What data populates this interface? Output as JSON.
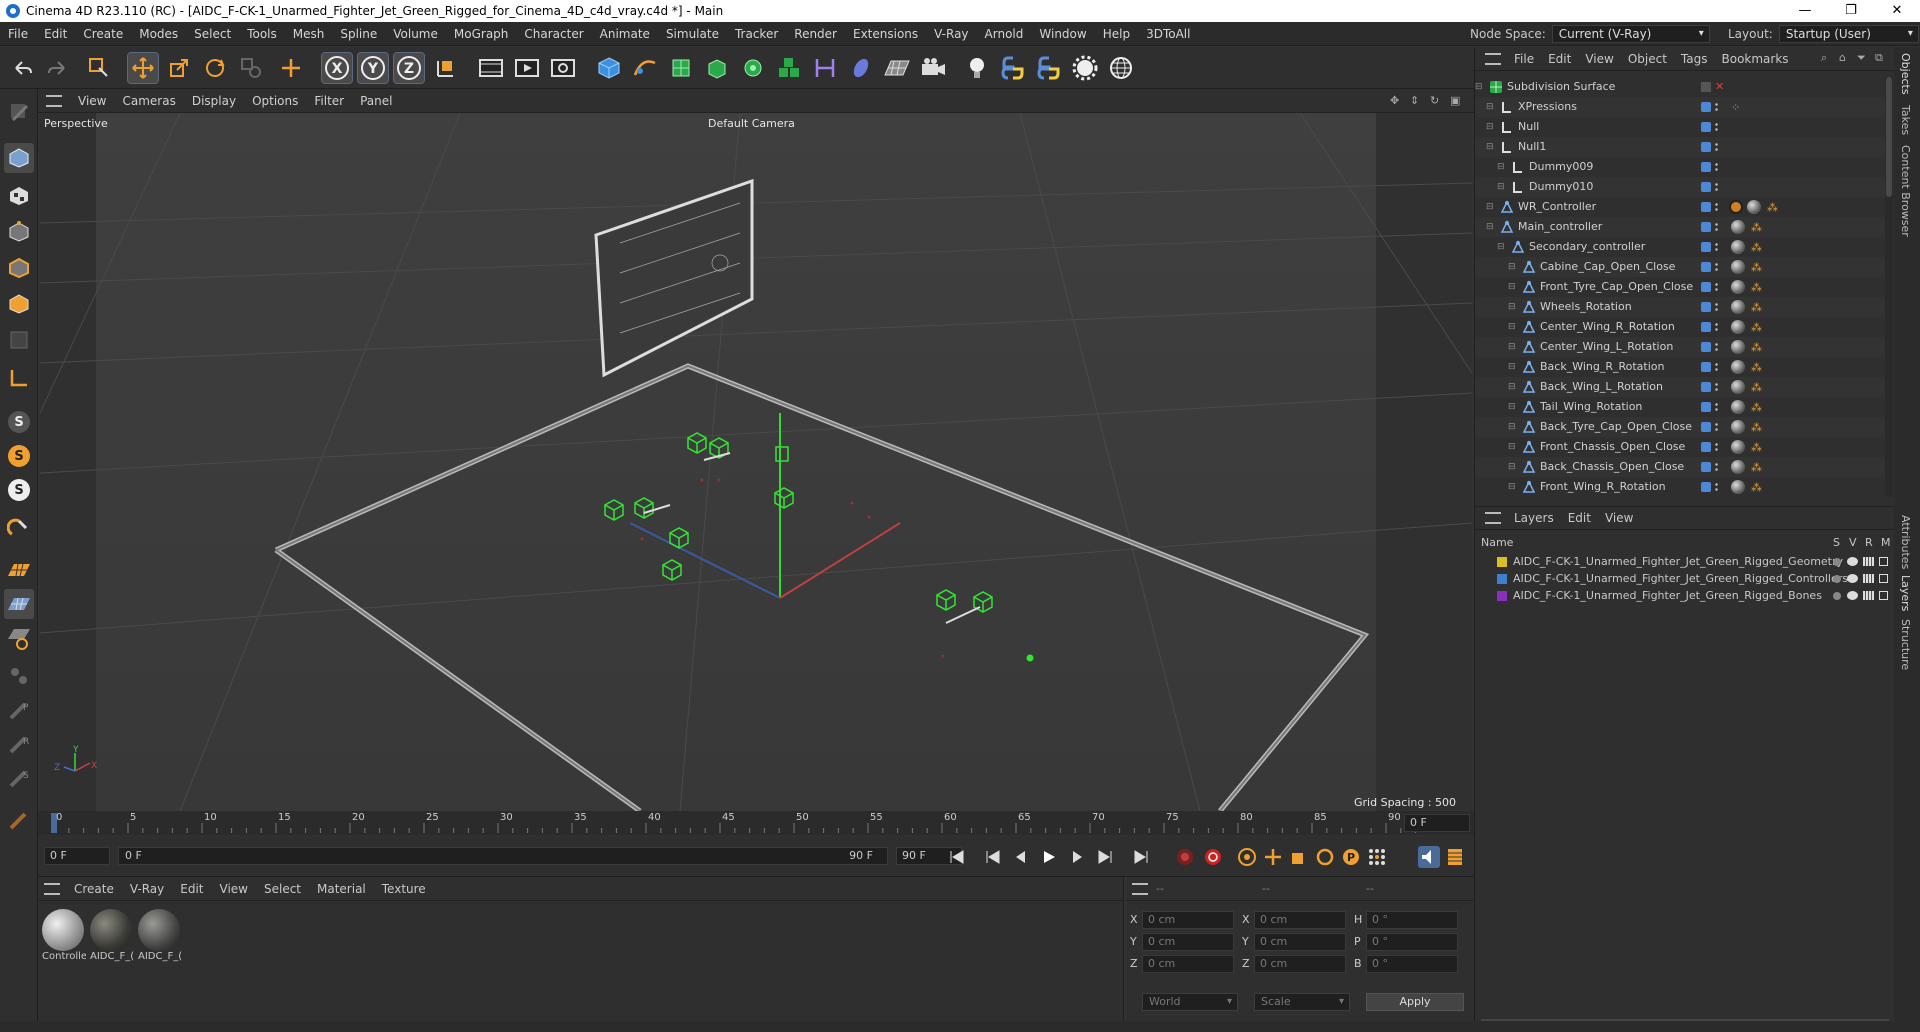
{
  "window": {
    "title": "Cinema 4D R23.110 (RC) - [AIDC_F-CK-1_Unarmed_Fighter_Jet_Green_Rigged_for_Cinema_4D_c4d_vray.c4d *] - Main",
    "minimize": "—",
    "maximize": "❐",
    "close": "✕"
  },
  "menu": [
    "File",
    "Edit",
    "Create",
    "Modes",
    "Select",
    "Tools",
    "Mesh",
    "Spline",
    "Volume",
    "MoGraph",
    "Character",
    "Animate",
    "Simulate",
    "Tracker",
    "Render",
    "Extensions",
    "V-Ray",
    "Arnold",
    "Window",
    "Help",
    "3DToAll"
  ],
  "node_space": {
    "label": "Node Space:",
    "value": "Current (V-Ray)"
  },
  "layout": {
    "label": "Layout:",
    "value": "Startup (User)"
  },
  "viewport": {
    "menu": [
      "View",
      "Cameras",
      "Display",
      "Options",
      "Filter",
      "Panel"
    ],
    "name": "Perspective",
    "camera": "Default Camera",
    "grid_spacing": "Grid Spacing : 500 cm",
    "axis": {
      "y": "Y",
      "x": "X",
      "z": "Z"
    }
  },
  "timeline": {
    "ticks": [
      "0",
      "5",
      "10",
      "15",
      "20",
      "25",
      "30",
      "35",
      "40",
      "45",
      "50",
      "55",
      "60",
      "65",
      "70",
      "75",
      "80",
      "85",
      "90"
    ],
    "current_frame": "0 F"
  },
  "anim": {
    "start": "0 F",
    "range_start": "0 F",
    "range_end": "90 F",
    "end": "90 F"
  },
  "materials": {
    "menu": [
      "Create",
      "V-Ray",
      "Edit",
      "View",
      "Select",
      "Material",
      "Texture"
    ],
    "items": [
      "Controlle",
      "AIDC_F_(",
      "AIDC_F_("
    ]
  },
  "coords": {
    "headers": [
      "--",
      "--",
      "--"
    ],
    "rows": [
      {
        "a": "X",
        "av": "0 cm",
        "b": "X",
        "bv": "0 cm",
        "c": "H",
        "cv": "0 °"
      },
      {
        "a": "Y",
        "av": "0 cm",
        "b": "Y",
        "bv": "0 cm",
        "c": "P",
        "cv": "0 °"
      },
      {
        "a": "Z",
        "av": "0 cm",
        "b": "Z",
        "bv": "0 cm",
        "c": "B",
        "cv": "0 °"
      }
    ],
    "mode": "World",
    "scale": "Scale",
    "apply": "Apply"
  },
  "objects": {
    "menu": [
      "File",
      "Edit",
      "View",
      "Object",
      "Tags",
      "Bookmarks"
    ],
    "rows": [
      {
        "name": "Subdivision Surface",
        "indent": 0
      },
      {
        "name": "XPressions",
        "indent": 1
      },
      {
        "name": "Null",
        "indent": 1
      },
      {
        "name": "Null1",
        "indent": 1
      },
      {
        "name": "Dummy009",
        "indent": 2
      },
      {
        "name": "Dummy010",
        "indent": 2
      },
      {
        "name": "WR_Controller",
        "indent": 1
      },
      {
        "name": "Main_controller",
        "indent": 1
      },
      {
        "name": "Secondary_controller",
        "indent": 2
      },
      {
        "name": "Cabine_Cap_Open_Close",
        "indent": 3
      },
      {
        "name": "Front_Tyre_Cap_Open_Close",
        "indent": 3
      },
      {
        "name": "Wheels_Rotation",
        "indent": 3
      },
      {
        "name": "Center_Wing_R_Rotation",
        "indent": 3
      },
      {
        "name": "Center_Wing_L_Rotation",
        "indent": 3
      },
      {
        "name": "Back_Wing_R_Rotation",
        "indent": 3
      },
      {
        "name": "Back_Wing_L_Rotation",
        "indent": 3
      },
      {
        "name": "Tail_Wing_Rotation",
        "indent": 3
      },
      {
        "name": "Back_Tyre_Cap_Open_Close",
        "indent": 3
      },
      {
        "name": "Front_Chassis_Open_Close",
        "indent": 3
      },
      {
        "name": "Back_Chassis_Open_Close",
        "indent": 3
      },
      {
        "name": "Front_Wing_R_Rotation",
        "indent": 3
      }
    ]
  },
  "layers": {
    "menu": [
      "Layers",
      "Edit",
      "View"
    ],
    "header": {
      "name": "Name",
      "s": "S",
      "v": "V",
      "r": "R",
      "m": "M"
    },
    "rows": [
      {
        "name": "AIDC_F-CK-1_Unarmed_Fighter_Jet_Green_Rigged_Geometry",
        "color": "#d8c020"
      },
      {
        "name": "AIDC_F-CK-1_Unarmed_Fighter_Jet_Green_Rigged_Controllers",
        "color": "#3f7fd0"
      },
      {
        "name": "AIDC_F-CK-1_Unarmed_Fighter_Jet_Green_Rigged_Bones",
        "color": "#8a2fc0"
      }
    ]
  },
  "side_tabs": [
    "Objects",
    "Takes",
    "Content Browser",
    "Attributes",
    "Layers",
    "Structure"
  ],
  "colors": {
    "accent": "#4b88d6",
    "controller": "#31e831",
    "bg": "#2f2f2f"
  }
}
